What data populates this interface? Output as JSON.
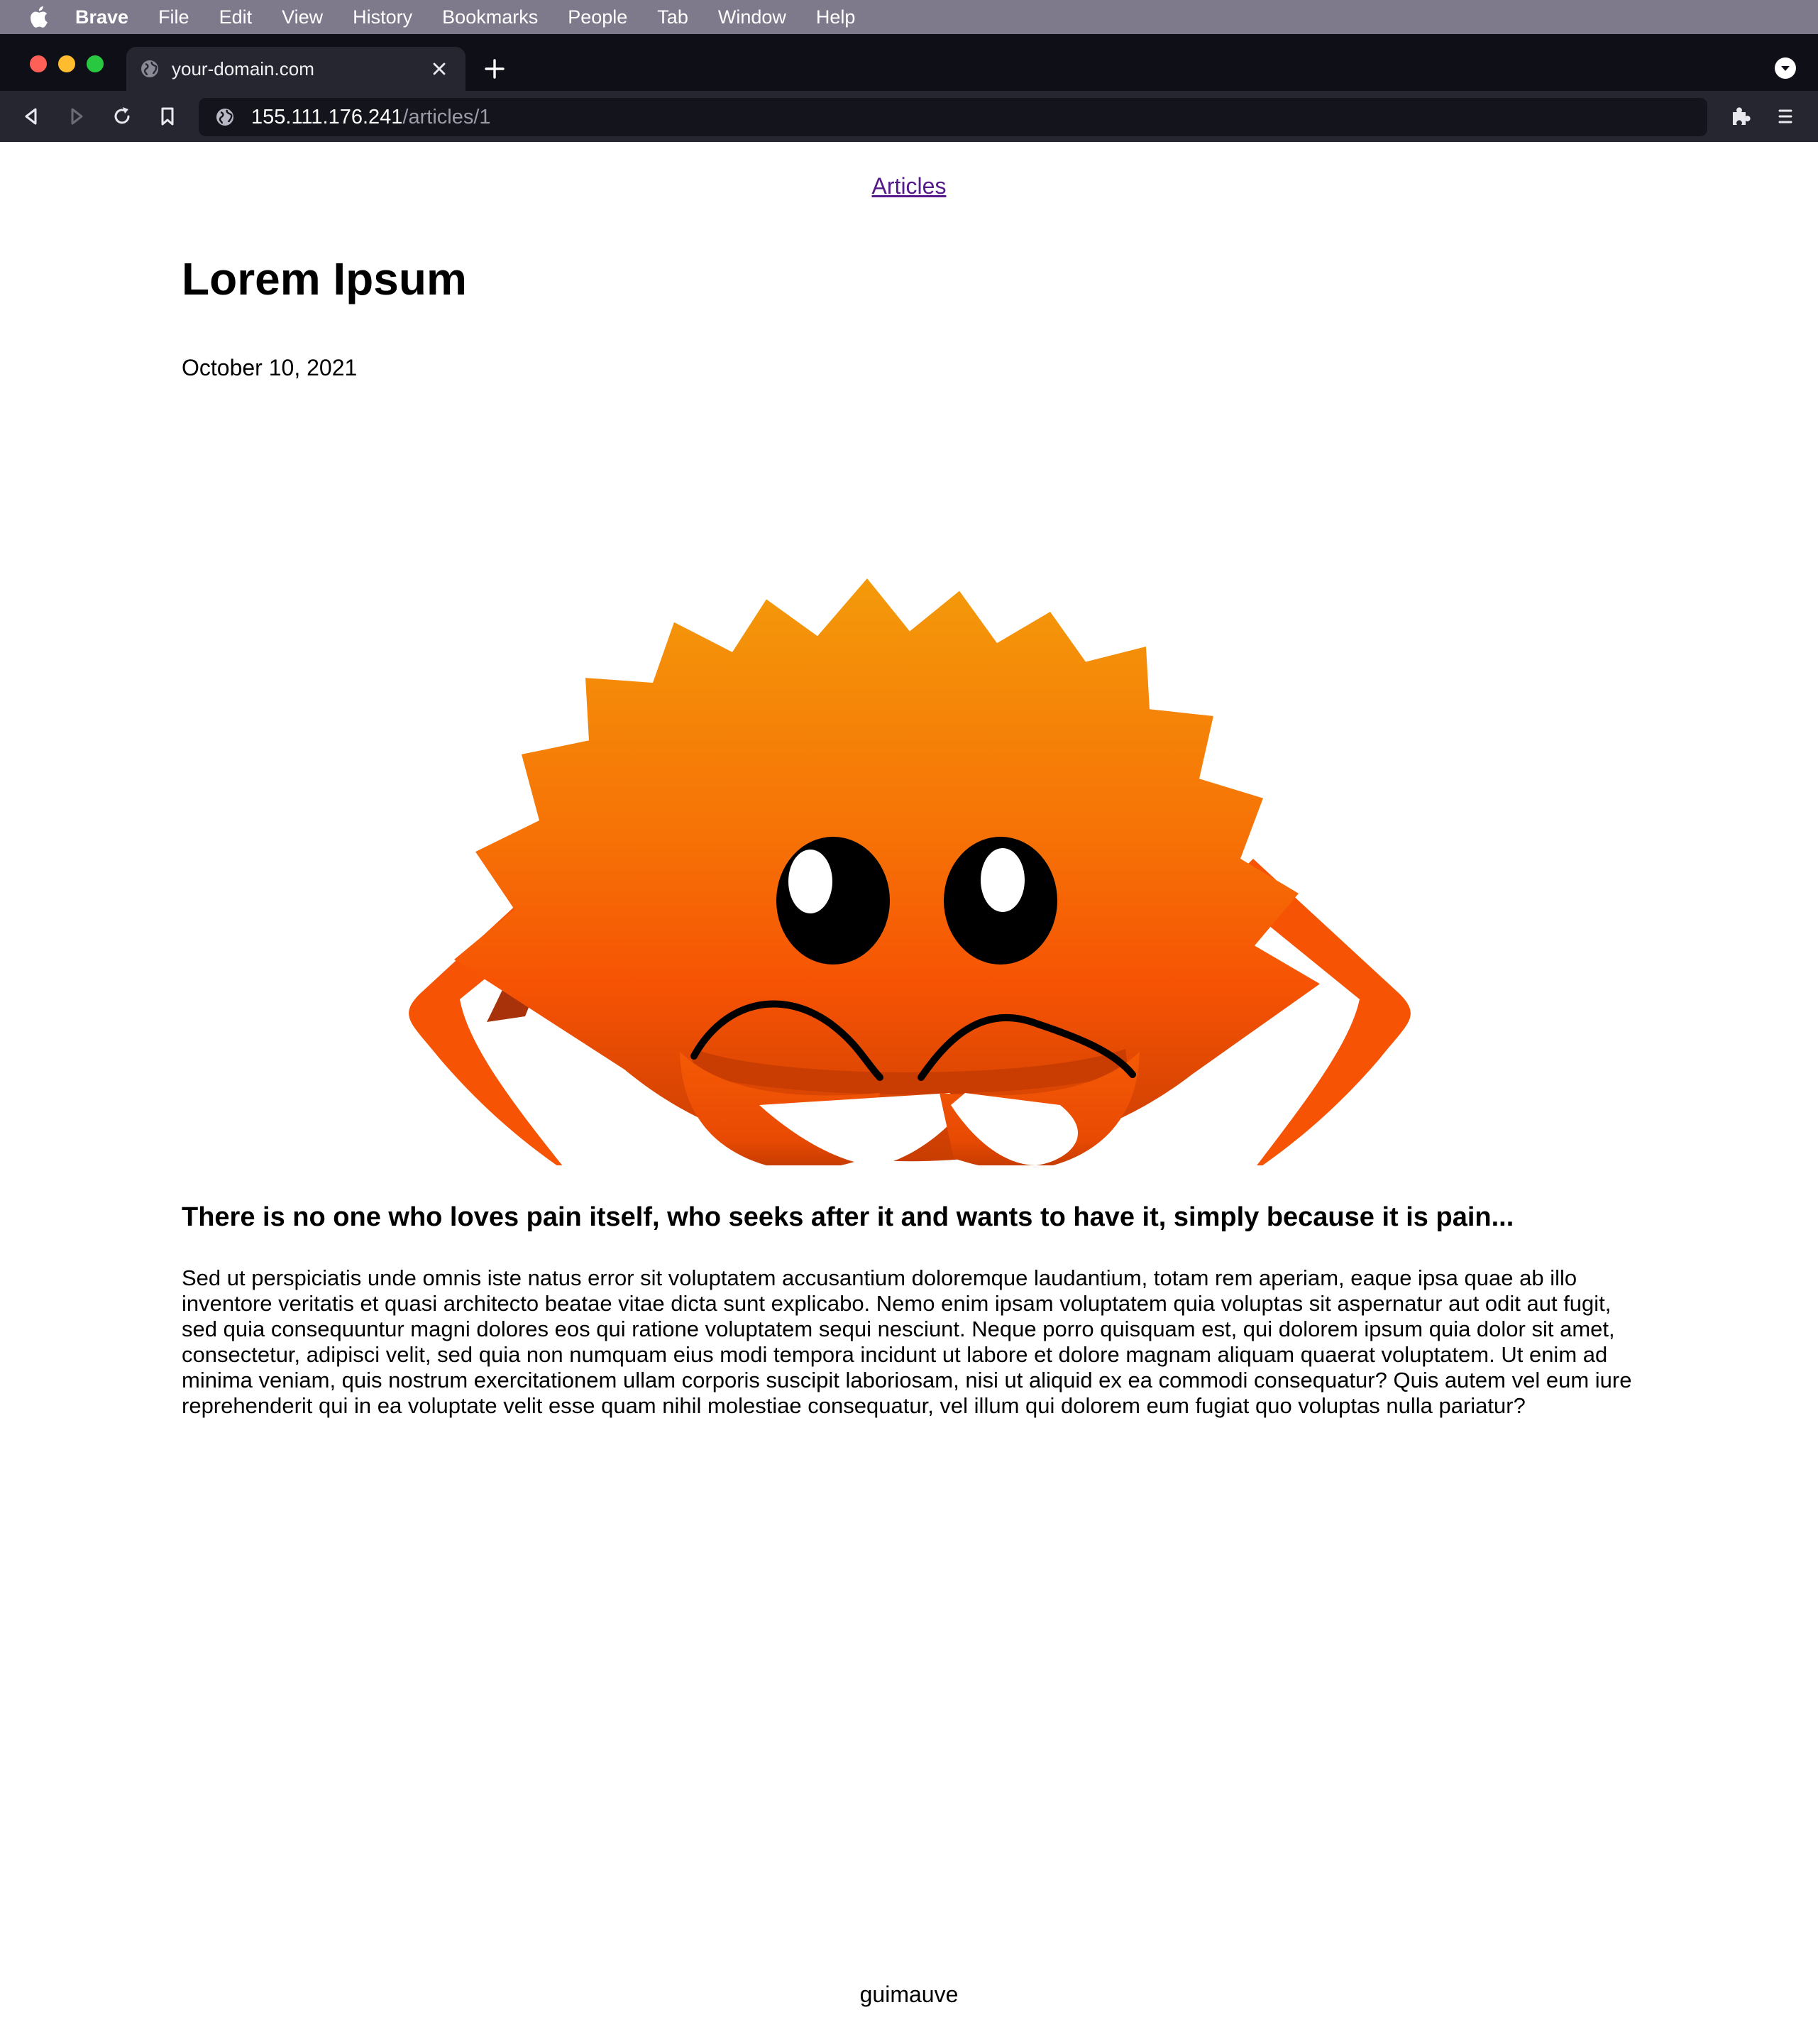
{
  "menubar": {
    "app_name": "Brave",
    "items": [
      "File",
      "Edit",
      "View",
      "History",
      "Bookmarks",
      "People",
      "Tab",
      "Window",
      "Help"
    ]
  },
  "browser": {
    "tab": {
      "title": "your-domain.com",
      "favicon": "globe-icon"
    },
    "url": {
      "host": "155.111.176.241",
      "path": "/articles/1"
    }
  },
  "page": {
    "nav_link": "Articles",
    "title": "Lorem Ipsum",
    "date": "October 10, 2021",
    "subtitle": "There is no one who loves pain itself, who seeks after it and wants to have it, simply because it is pain...",
    "body": "Sed ut perspiciatis unde omnis iste natus error sit voluptatem accusantium doloremque laudantium, totam rem aperiam, eaque ipsa quae ab illo inventore veritatis et quasi architecto beatae vitae dicta sunt explicabo. Nemo enim ipsam voluptatem quia voluptas sit aspernatur aut odit aut fugit, sed quia consequuntur magni dolores eos qui ratione voluptatem sequi nesciunt. Neque porro quisquam est, qui dolorem ipsum quia dolor sit amet, consectetur, adipisci velit, sed quia non numquam eius modi tempora incidunt ut labore et dolore magnam aliquam quaerat voluptatem. Ut enim ad minima veniam, quis nostrum exercitationem ullam corporis suscipit laboriosam, nisi ut aliquid ex ea commodi consequatur? Quis autem vel eum iure reprehenderit qui in ea voluptate velit esse quam nihil molestiae consequatur, vel illum qui dolorem eum fugiat quo voluptas nulla pariatur?",
    "hero_image": "ferris-crab-mascot",
    "footer": "guimauve"
  },
  "colors": {
    "menubar_bg": "#7e7a8c",
    "chrome_bg": "#0f0f17",
    "toolbar_bg": "#262630",
    "link_visited": "#551a8b",
    "crab_top": "#f49a0a",
    "crab_mid": "#f65a06",
    "crab_bottom": "#c93d02"
  }
}
